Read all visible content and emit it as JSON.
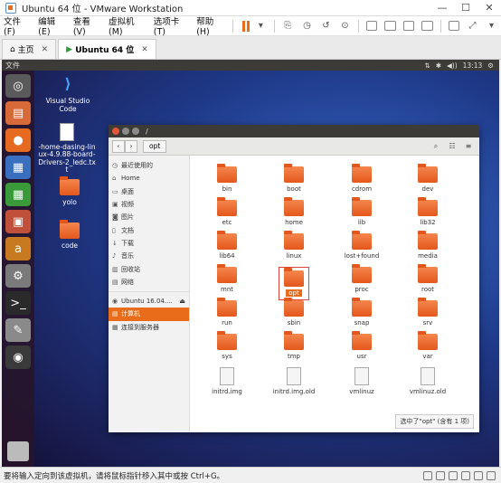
{
  "window": {
    "title": "Ubuntu 64 位 - VMware Workstation"
  },
  "menu": [
    "文件(F)",
    "编辑(E)",
    "查看(V)",
    "虚拟机(M)",
    "选项卡(T)",
    "帮助(H)"
  ],
  "tabs": [
    {
      "label": "主页"
    },
    {
      "label": "Ubuntu 64 位"
    }
  ],
  "guest": {
    "topbar_label": "文件",
    "tray": [
      "⇅",
      "✱",
      "◀))",
      "13:13",
      "⚙"
    ],
    "time": "13:13"
  },
  "desktop_icons": [
    {
      "label": "Visual Studio Code"
    },
    {
      "label": "-home-dasing-linux-4.9.88-board-Drivers-2_ledc.txt"
    },
    {
      "label": "yolo"
    },
    {
      "label": "code"
    }
  ],
  "file_manager": {
    "title": "/",
    "path": "opt",
    "sidebar": [
      {
        "label": "最近使用的",
        "icon": "clock-icon"
      },
      {
        "label": "Home",
        "icon": "home-icon"
      },
      {
        "label": "桌面",
        "icon": "desktop-icon"
      },
      {
        "label": "视频",
        "icon": "video-icon"
      },
      {
        "label": "图片",
        "icon": "camera-icon"
      },
      {
        "label": "文档",
        "icon": "document-icon"
      },
      {
        "label": "下载",
        "icon": "download-icon"
      },
      {
        "label": "音乐",
        "icon": "music-icon"
      },
      {
        "label": "回收站",
        "icon": "trash-icon"
      },
      {
        "label": "网络",
        "icon": "network-icon"
      }
    ],
    "devices": [
      {
        "label": "Ubuntu 16.04....",
        "icon": "disc-icon"
      },
      {
        "label": "计算机",
        "icon": "computer-icon",
        "active": true
      },
      {
        "label": "连接到服务器",
        "icon": "server-icon"
      }
    ],
    "items": [
      {
        "name": "bin",
        "type": "folder"
      },
      {
        "name": "boot",
        "type": "folder"
      },
      {
        "name": "cdrom",
        "type": "folder"
      },
      {
        "name": "dev",
        "type": "folder"
      },
      {
        "name": "etc",
        "type": "folder"
      },
      {
        "name": "home",
        "type": "folder"
      },
      {
        "name": "lib",
        "type": "folder"
      },
      {
        "name": "lib32",
        "type": "folder"
      },
      {
        "name": "lib64",
        "type": "folder"
      },
      {
        "name": "linux",
        "type": "folder"
      },
      {
        "name": "lost+found",
        "type": "folder-locked"
      },
      {
        "name": "media",
        "type": "folder"
      },
      {
        "name": "mnt",
        "type": "folder"
      },
      {
        "name": "opt",
        "type": "folder",
        "selected": true
      },
      {
        "name": "proc",
        "type": "folder"
      },
      {
        "name": "root",
        "type": "folder-locked"
      },
      {
        "name": "run",
        "type": "folder"
      },
      {
        "name": "sbin",
        "type": "folder"
      },
      {
        "name": "snap",
        "type": "folder"
      },
      {
        "name": "srv",
        "type": "folder"
      },
      {
        "name": "sys",
        "type": "folder"
      },
      {
        "name": "tmp",
        "type": "folder"
      },
      {
        "name": "usr",
        "type": "folder"
      },
      {
        "name": "var",
        "type": "folder"
      },
      {
        "name": "initrd.img",
        "type": "file"
      },
      {
        "name": "initrd.img.old",
        "type": "file"
      },
      {
        "name": "vmlinuz",
        "type": "file"
      },
      {
        "name": "vmlinuz.old",
        "type": "file"
      }
    ],
    "status": "选中了\"opt\" (含有 1 项)"
  },
  "status_bar": "要将输入定向到该虚拟机，请将鼠标指针移入其中或按 Ctrl+G。",
  "colors": {
    "accent": "#e86c1a",
    "folder": "#e4571c",
    "topbar": "#3c3b37"
  }
}
